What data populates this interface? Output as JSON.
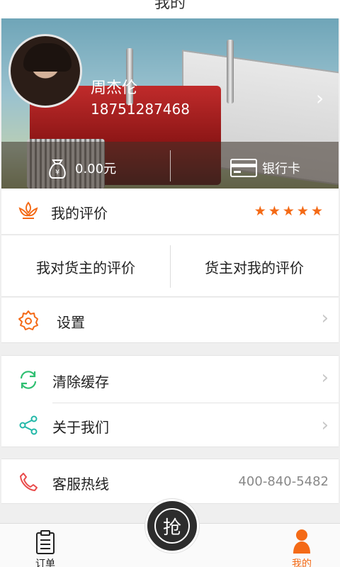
{
  "header": {
    "title": "我的"
  },
  "profile": {
    "name": "周杰伦",
    "phone": "18751287468",
    "balance": "0.00元",
    "bank_card_label": "银行卡"
  },
  "rating": {
    "label": "我的评价",
    "stars": 5,
    "star_glyph": "★",
    "my_eval_of_shipper": "我对货主的评价",
    "shipper_eval_of_me": "货主对我的评价"
  },
  "settings": {
    "label": "设置"
  },
  "menu": {
    "clear_cache": "清除缓存",
    "about_us": "关于我们"
  },
  "hotline": {
    "label": "客服热线",
    "number": "400-840-5482"
  },
  "tabbar": {
    "orders": "订单",
    "grab": "抢",
    "mine": "我的"
  },
  "colors": {
    "accent": "#f46a16",
    "icon_orange": "#f46a16",
    "icon_green": "#2fbf71",
    "icon_teal": "#22b8a8",
    "icon_red": "#e94b4b"
  },
  "icons": {
    "rating": "flower-icon",
    "settings": "gear-icon",
    "clear_cache": "refresh-icon",
    "about_us": "share-icon",
    "hotline": "phone-icon",
    "orders": "clipboard-icon",
    "mine": "person-icon"
  }
}
